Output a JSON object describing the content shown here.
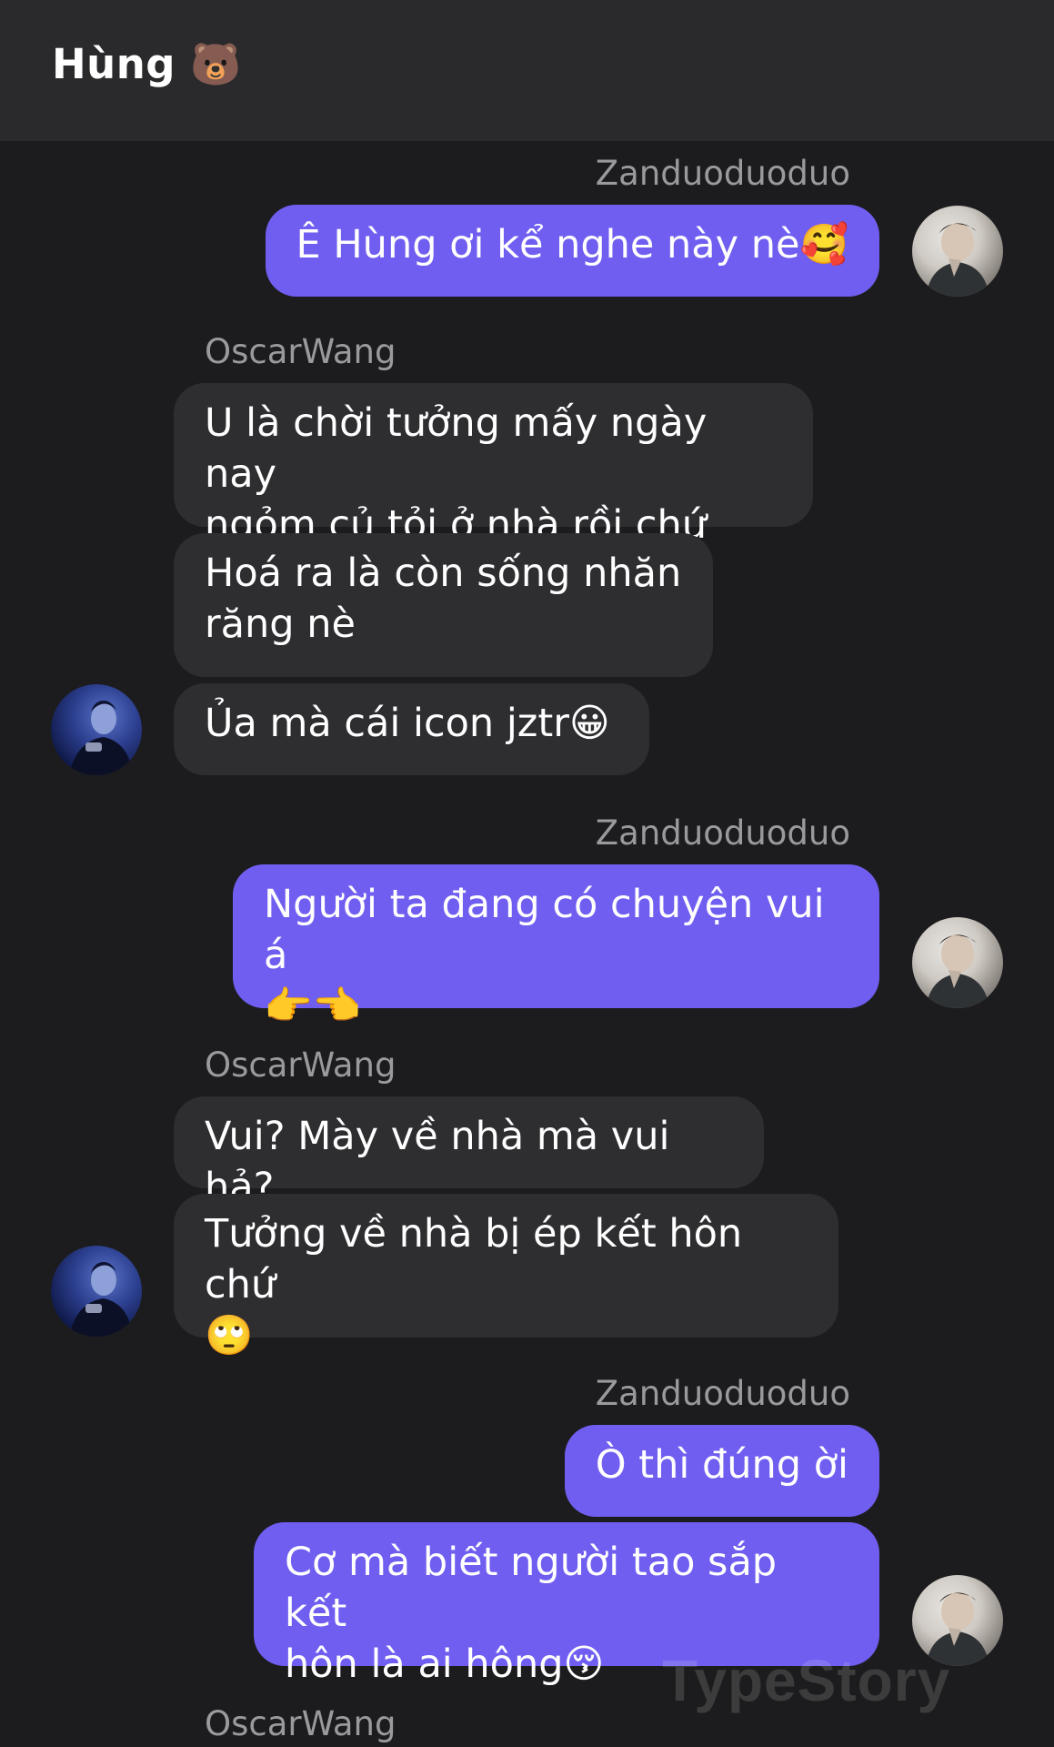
{
  "header": {
    "title": "Hùng 🐻"
  },
  "messages": {
    "g1": {
      "sender": "Zanduoduoduo",
      "b1": "Ê Hùng ơi kể nghe này nè🥰"
    },
    "g2": {
      "sender": "OscarWang",
      "b1": "U là chời tưởng mấy ngày nay\nngỏm củ tỏi ở nhà rồi chứ",
      "b2": "Hoá ra là còn sống nhăn\nrăng nè",
      "b3": "Ủa mà cái icon jztr😀"
    },
    "g3": {
      "sender": "Zanduoduoduo",
      "b1": "Người ta đang có chuyện vui á\n👉👈"
    },
    "g4": {
      "sender": "OscarWang",
      "b1": "Vui? Mày về nhà mà vui hả?",
      "b2": "Tưởng về nhà bị ép kết hôn chứ\n🙄"
    },
    "g5": {
      "sender": "Zanduoduoduo",
      "b1": "Ò thì đúng ời",
      "b2": "Cơ mà biết người tao sắp kết\nhôn là ai hông😚"
    },
    "g6": {
      "sender": "OscarWang"
    }
  },
  "watermark": "TypeStory",
  "colors": {
    "background": "#1c1c1e",
    "header": "#2a2a2c",
    "my_bubble": "#6f5ef0",
    "their_bubble": "#2e2e31",
    "sender_name": "#9a9a9e"
  }
}
